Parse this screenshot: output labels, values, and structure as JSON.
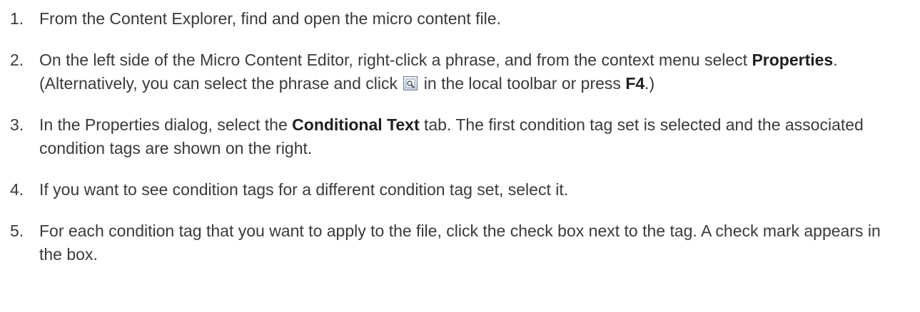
{
  "steps": [
    {
      "num": "1.",
      "text": "From the Content Explorer, find and open the micro content file."
    },
    {
      "num": "2.",
      "text_a": "On the left side of the Micro Content Editor, right-click a phrase, and from the context menu select ",
      "bold_a": "Properties",
      "text_b": ". (Alternatively, you can select the phrase and click ",
      "icon": "properties-icon",
      "text_c": " in the local toolbar or press ",
      "bold_b": "F4",
      "text_d": ".)"
    },
    {
      "num": "3.",
      "text_a": "In the Properties dialog, select the ",
      "bold_a": "Conditional Text",
      "text_b": " tab. The first condition tag set is selected and the associated condition tags are shown on the right."
    },
    {
      "num": "4.",
      "text": "If you want to see condition tags for a different condition tag set, select it."
    },
    {
      "num": "5.",
      "text": "For each condition tag that you want to apply to the file, click the check box next to the tag. A check mark appears in the box."
    }
  ]
}
